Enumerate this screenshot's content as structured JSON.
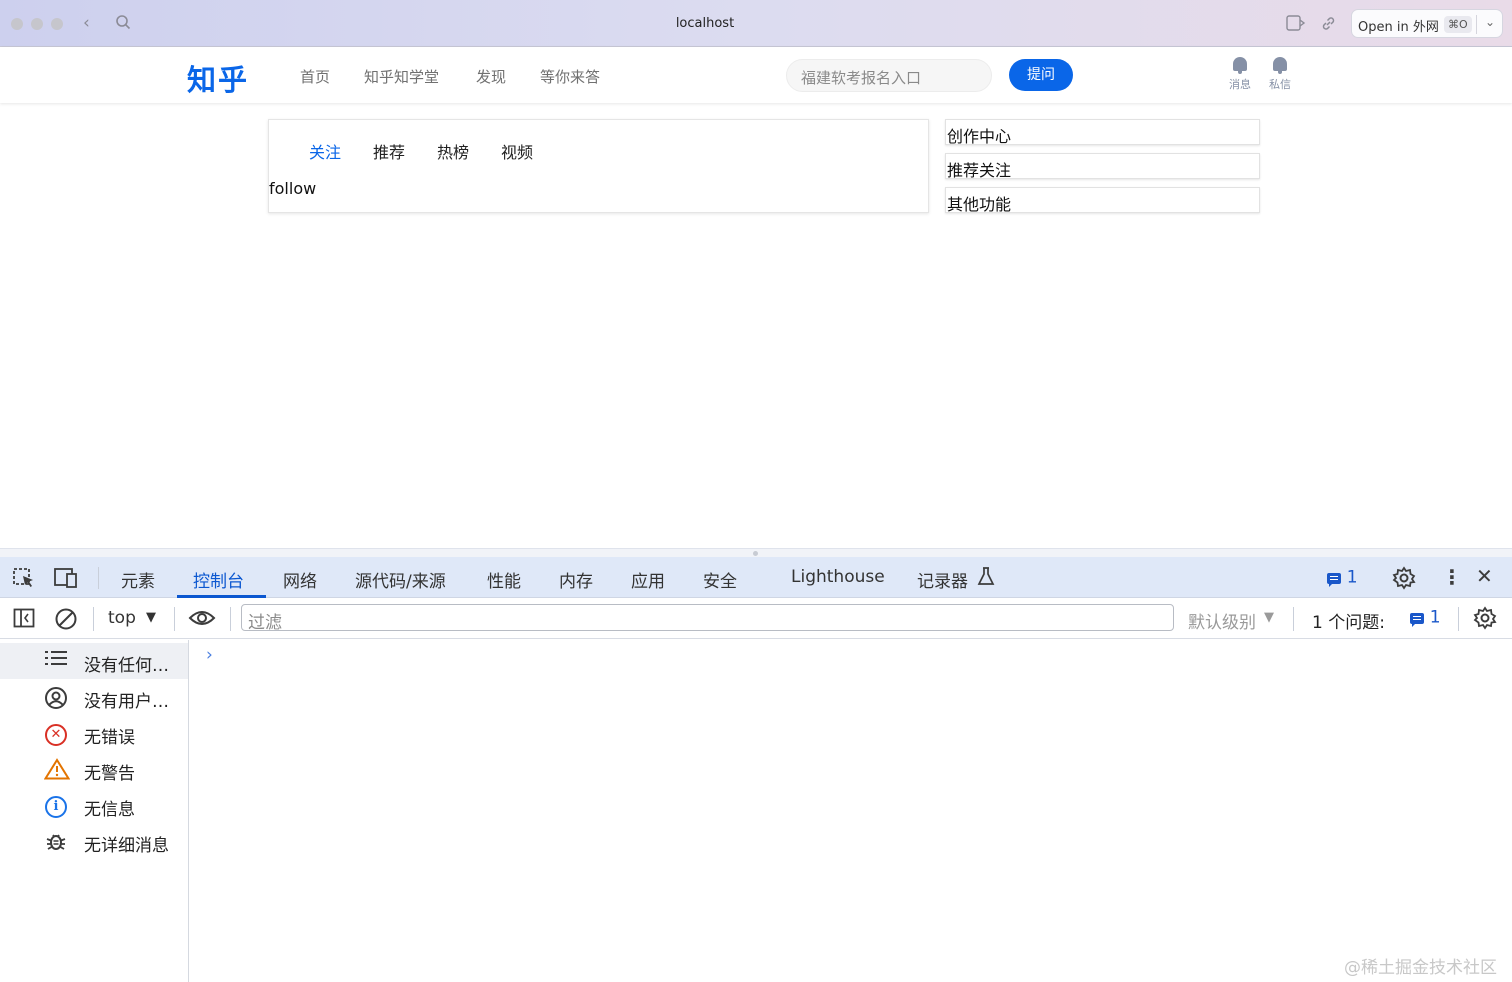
{
  "browser": {
    "url": "localhost",
    "open_in": {
      "label": "Open in 外网",
      "shortcut": "⌘O"
    }
  },
  "site": {
    "logo": "知乎",
    "nav": [
      "首页",
      "知乎知学堂",
      "发现",
      "等你来答"
    ],
    "search_placeholder": "福建软考报名入口",
    "ask_button": "提问",
    "header_icons": {
      "messages": "消息",
      "private_messages": "私信"
    }
  },
  "feed": {
    "tabs": [
      {
        "label": "关注",
        "active": true
      },
      {
        "label": "推荐",
        "active": false
      },
      {
        "label": "热榜",
        "active": false
      },
      {
        "label": "视频",
        "active": false
      }
    ],
    "content": "follow"
  },
  "sidebar_cards": [
    "创作中心",
    "推荐关注",
    "其他功能"
  ],
  "devtools": {
    "tabs": [
      "元素",
      "控制台",
      "网络",
      "源代码/来源",
      "性能",
      "内存",
      "应用",
      "安全",
      "Lighthouse",
      "记录器"
    ],
    "active_tab": "控制台",
    "issues_badge_count": "1",
    "context": "top",
    "filter_placeholder": "过滤",
    "log_level": "默认级别",
    "issues_label": "1 个问题:",
    "issues_count": "1",
    "console_sidebar": [
      {
        "label": "没有任何…",
        "icon": "list-icon",
        "selected": true
      },
      {
        "label": "没有用户…",
        "icon": "user-icon",
        "selected": false
      },
      {
        "label": "无错误",
        "icon": "error-icon",
        "selected": false
      },
      {
        "label": "无警告",
        "icon": "warning-icon",
        "selected": false
      },
      {
        "label": "无信息",
        "icon": "info-icon",
        "selected": false
      },
      {
        "label": "无详细消息",
        "icon": "bug-icon",
        "selected": false
      }
    ],
    "prompt_symbol": "›"
  },
  "watermark": "@稀土掘金技术社区",
  "colors": {
    "zhihu_blue": "#0a66e8",
    "devtools_blue": "#0b57d0",
    "error": "#d93025",
    "warning": "#e37400",
    "info": "#1a73e8"
  }
}
